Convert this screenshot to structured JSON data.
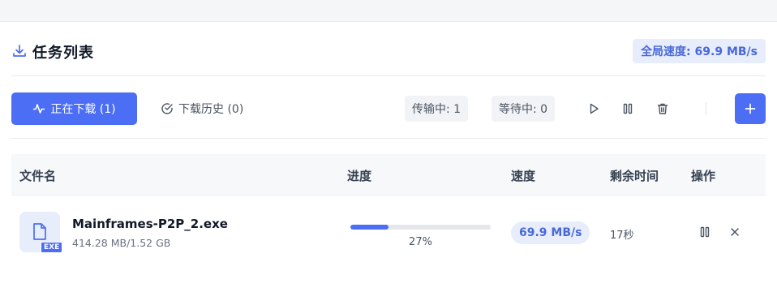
{
  "header": {
    "title": "任务列表",
    "global_speed": "全局速度: 69.9 MB/s"
  },
  "tabs": {
    "active_label": "正在下载 (1)",
    "history_label": "下载历史 (0)"
  },
  "stats": {
    "transferring": "传输中: 1",
    "waiting": "等待中: 0"
  },
  "table": {
    "columns": [
      "文件名",
      "进度",
      "速度",
      "剩余时间",
      "操作"
    ],
    "rows": [
      {
        "name": "Mainframes-P2P_2.exe",
        "size": "414.28 MB/1.52 GB",
        "ext": "EXE",
        "progress_percent": 27,
        "progress_text": "27%",
        "speed": "69.9 MB/s",
        "remaining": "17秒"
      }
    ]
  },
  "colors": {
    "accent": "#4c6ef5",
    "accent_light": "#e8edfb"
  },
  "icons": {
    "header": "download-icon",
    "active_tab": "activity-icon",
    "history_tab": "check-circle-icon",
    "start_all": "play-icon",
    "pause_all": "pause-icon",
    "delete_all": "trash-icon",
    "add": "plus-icon",
    "file": "file-icon",
    "row_pause": "pause-icon",
    "row_remove": "close-icon"
  }
}
